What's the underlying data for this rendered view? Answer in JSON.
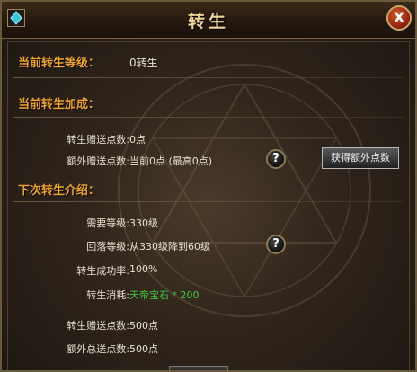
{
  "window": {
    "title": "转生",
    "close_label": "X"
  },
  "current": {
    "level_label": "当前转生等级：",
    "level_value": "0转生"
  },
  "bonus": {
    "section_label": "当前转生加成：",
    "gift_points_label": "转生赠送点数:",
    "gift_points_value": "0点",
    "extra_points_label": "额外赠送点数:",
    "extra_points_value": "当前0点 (最高0点)",
    "get_extra_button": "获得额外点数"
  },
  "next": {
    "section_label": "下次转生介绍：",
    "req_level_label": "需要等级:",
    "req_level_value": "330级",
    "drop_level_label": "回落等级:",
    "drop_level_value": "从330级降到60级",
    "success_label": "转生成功率:",
    "success_value": "100%",
    "cost_label": "转生消耗:",
    "cost_value": "天帝宝石 * 200",
    "gift_points_label": "转生赠送点数:",
    "gift_points_value": "500点",
    "total_extra_label": "额外总送点数:",
    "total_extra_value": "500点"
  },
  "help_icon_glyph": "?",
  "colors": {
    "section": "#f0a32e",
    "text": "#e8e2d2",
    "highlight": "#3fc63f"
  }
}
